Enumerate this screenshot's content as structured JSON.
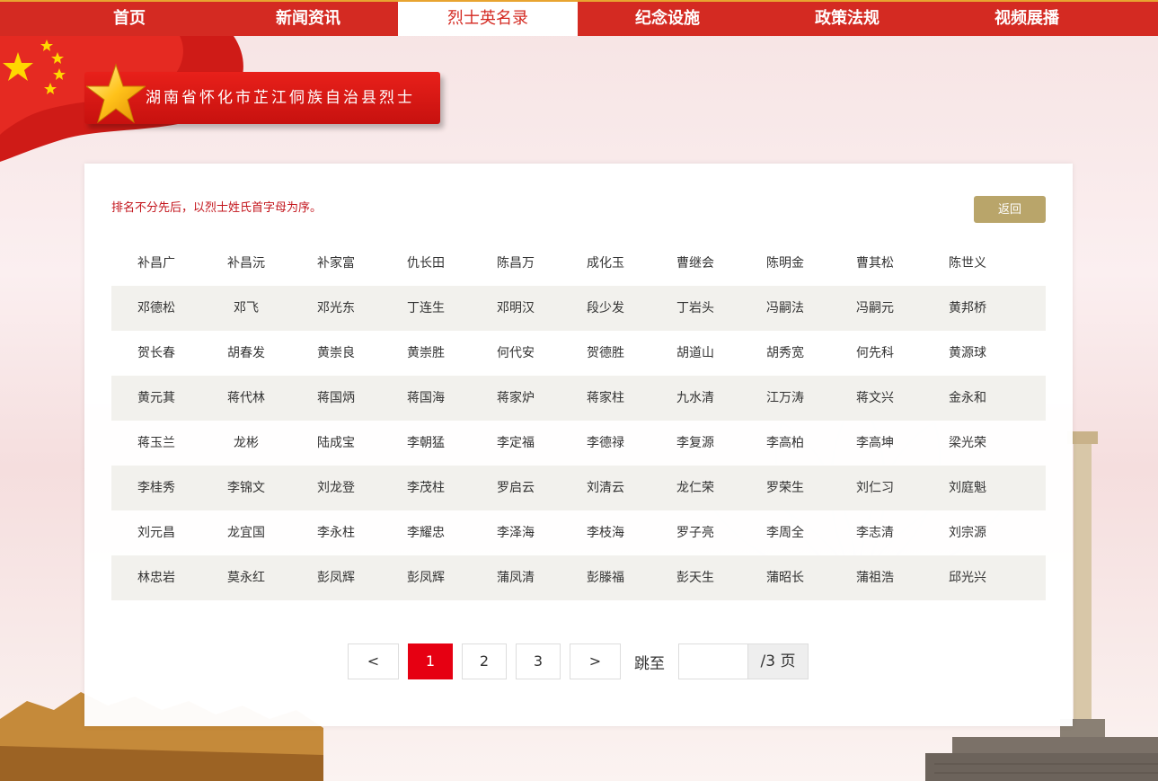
{
  "nav": {
    "items": [
      {
        "label": "首页"
      },
      {
        "label": "新闻资讯"
      },
      {
        "label": "烈士英名录"
      },
      {
        "label": "纪念设施"
      },
      {
        "label": "政策法规"
      },
      {
        "label": "视频展播"
      }
    ],
    "active_index": 2
  },
  "ribbon": {
    "title": "湖南省怀化市芷江侗族自治县烈士"
  },
  "panel": {
    "note": "排名不分先后，以烈士姓氏首字母为序。",
    "back_label": "返回"
  },
  "names": [
    [
      "补昌广",
      "补昌沅",
      "补家富",
      "仇长田",
      "陈昌万",
      "成化玉",
      "曹继会",
      "陈明金",
      "曹其松",
      "陈世义"
    ],
    [
      "邓德松",
      "邓飞",
      "邓光东",
      "丁连生",
      "邓明汉",
      "段少发",
      "丁岩头",
      "冯嗣法",
      "冯嗣元",
      "黄邦桥"
    ],
    [
      "贺长春",
      "胡春发",
      "黄崇良",
      "黄崇胜",
      "何代安",
      "贺德胜",
      "胡道山",
      "胡秀宽",
      "何先科",
      "黄源球"
    ],
    [
      "黄元萁",
      "蒋代林",
      "蒋国炳",
      "蒋国海",
      "蒋家炉",
      "蒋家柱",
      "九水清",
      "江万涛",
      "蒋文兴",
      "金永和"
    ],
    [
      "蒋玉兰",
      "龙彬",
      "陆成宝",
      "李朝猛",
      "李定福",
      "李德禄",
      "李复源",
      "李高柏",
      "李高坤",
      "梁光荣"
    ],
    [
      "李桂秀",
      "李锦文",
      "刘龙登",
      "李茂柱",
      "罗启云",
      "刘清云",
      "龙仁荣",
      "罗荣生",
      "刘仁习",
      "刘庭魁"
    ],
    [
      "刘元昌",
      "龙宜国",
      "李永柱",
      "李耀忠",
      "李泽海",
      "李枝海",
      "罗子亮",
      "李周全",
      "李志清",
      "刘宗源"
    ],
    [
      "林忠岩",
      "莫永红",
      "彭凤辉",
      "彭凤辉",
      "蒲凤清",
      "彭滕福",
      "彭天生",
      "蒲昭长",
      "蒲祖浩",
      "邱光兴"
    ]
  ],
  "pagination": {
    "prev_label": "<",
    "next_label": ">",
    "pages": [
      "1",
      "2",
      "3"
    ],
    "current_page": "1",
    "jump_label": "跳至",
    "jump_value": "",
    "total_label": "/3 页"
  },
  "colors": {
    "nav_bg": "#d42a22",
    "accent_red": "#e60012",
    "back_button": "#b9a56a",
    "note_text": "#c3151c"
  }
}
